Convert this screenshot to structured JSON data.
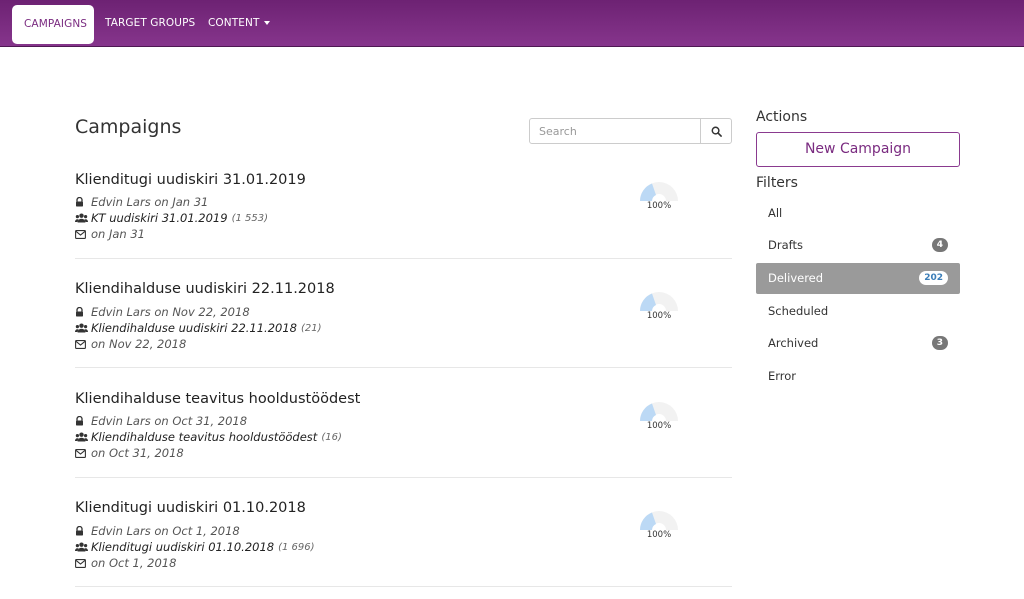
{
  "nav": {
    "items": [
      {
        "label": "CAMPAIGNS",
        "active": true
      },
      {
        "label": "TARGET GROUPS",
        "active": false
      },
      {
        "label": "CONTENT",
        "active": false,
        "dropdown": true
      }
    ]
  },
  "main": {
    "title": "Campaigns",
    "search_placeholder": "Search",
    "campaigns": [
      {
        "title": "Klienditugi uudiskiri 31.01.2019",
        "author": "Edvin Lars on Jan 31",
        "group": "KT uudiskiri 31.01.2019",
        "group_count": "(1 553)",
        "sent": "on Jan 31",
        "progress_label": "100%",
        "progress": 1.0
      },
      {
        "title": "Kliendihalduse uudiskiri 22.11.2018",
        "author": "Edvin Lars on Nov 22, 2018",
        "group": "Kliendihalduse uudiskiri 22.11.2018",
        "group_count": "(21)",
        "sent": "on Nov 22, 2018",
        "progress_label": "100%",
        "progress": 1.0
      },
      {
        "title": "Kliendihalduse teavitus hooldustöödest",
        "author": "Edvin Lars on Oct 31, 2018",
        "group": "Kliendihalduse teavitus hooldustöödest",
        "group_count": "(16)",
        "sent": "on Oct 31, 2018",
        "progress_label": "100%",
        "progress": 1.0
      },
      {
        "title": "Klienditugi uudiskiri 01.10.2018",
        "author": "Edvin Lars on Oct 1, 2018",
        "group": "Klienditugi uudiskiri 01.10.2018",
        "group_count": "(1 696)",
        "sent": "on Oct 1, 2018",
        "progress_label": "100%",
        "progress": 1.0
      }
    ]
  },
  "sidebar": {
    "actions_heading": "Actions",
    "new_campaign_label": "New Campaign",
    "filters_heading": "Filters",
    "filters": [
      {
        "label": "All",
        "badge": "",
        "active": false
      },
      {
        "label": "Drafts",
        "badge": "4",
        "active": false
      },
      {
        "label": "Delivered",
        "badge": "202",
        "active": true
      },
      {
        "label": "Scheduled",
        "badge": "",
        "active": false
      },
      {
        "label": "Archived",
        "badge": "3",
        "active": false
      },
      {
        "label": "Error",
        "badge": "",
        "active": false
      }
    ]
  },
  "colors": {
    "brand": "#7a2b80",
    "gauge_fill": "#bcd9f5",
    "gauge_track": "#f2f2f2",
    "active_filter": "#9a9a9a"
  }
}
